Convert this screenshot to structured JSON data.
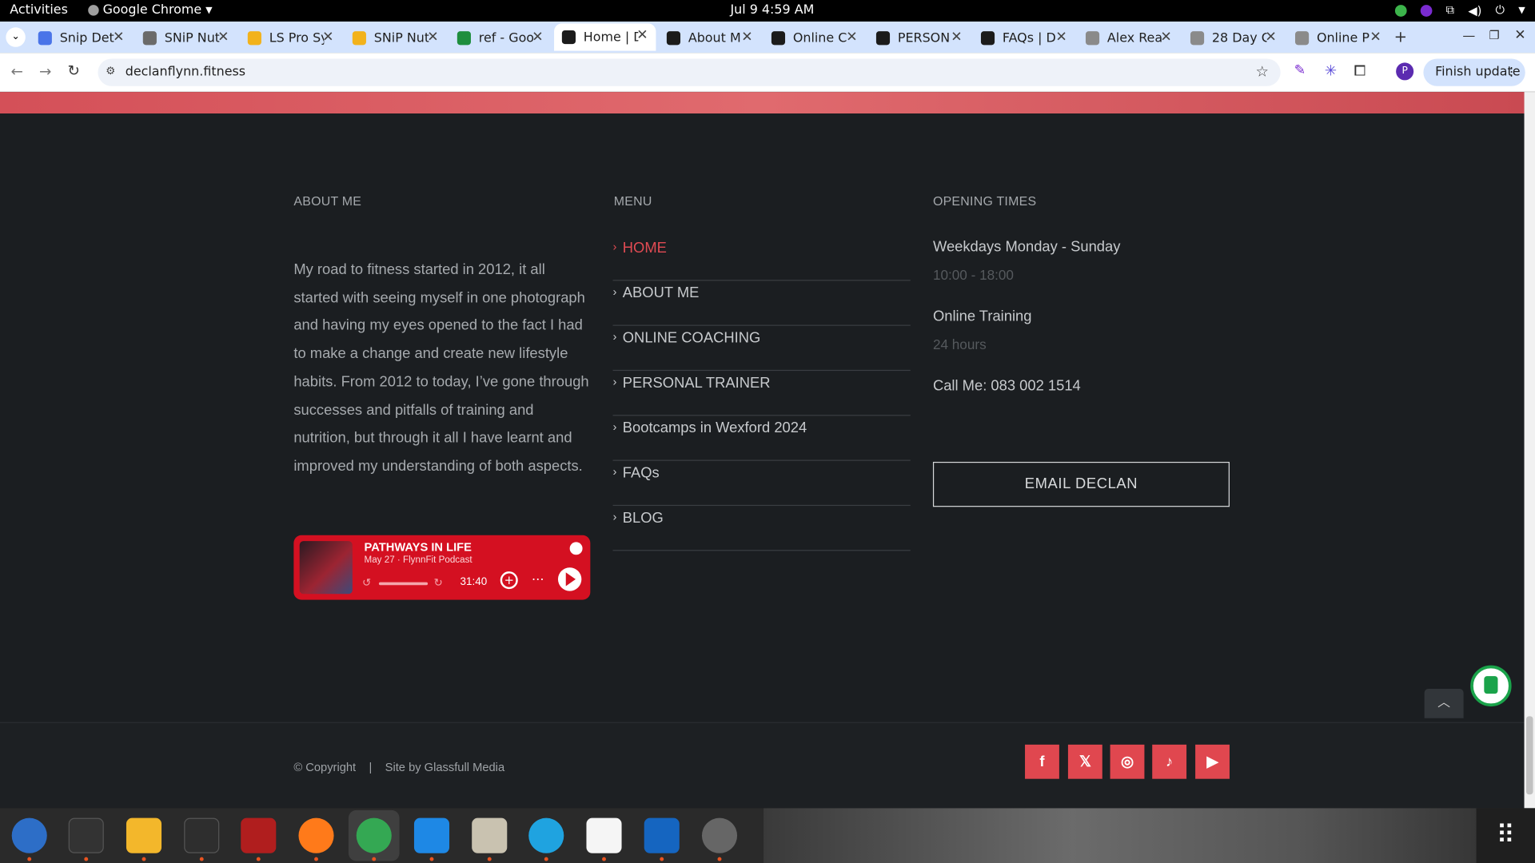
{
  "topbar": {
    "activities": "Activities",
    "app_name": "Google Chrome",
    "clock": "Jul 9  4:59 AM"
  },
  "tabs": [
    {
      "label": "Snip Det",
      "color": "#4a74e8"
    },
    {
      "label": "SNiP Nut",
      "color": "#6a6a6a"
    },
    {
      "label": "LS Pro Sy",
      "color": "#f2b21b"
    },
    {
      "label": "SNiP Nut",
      "color": "#f2b21b"
    },
    {
      "label": "ref - Goo",
      "color": "#1e8e3e"
    },
    {
      "label": "Home | D",
      "color": "#1b1b1b",
      "active": true
    },
    {
      "label": "About M",
      "color": "#1b1b1b"
    },
    {
      "label": "Online C",
      "color": "#1b1b1b"
    },
    {
      "label": "PERSON",
      "color": "#1b1b1b"
    },
    {
      "label": "FAQs | D",
      "color": "#1b1b1b"
    },
    {
      "label": "Alex Rea",
      "color": "#8a8a8a"
    },
    {
      "label": "28 Day C",
      "color": "#8a8a8a"
    },
    {
      "label": "Online P",
      "color": "#8a8a8a"
    }
  ],
  "toolbar": {
    "url": "declanflynn.fitness",
    "finish_update": "Finish update",
    "profile_initial": "P"
  },
  "footer": {
    "about": {
      "heading": "ABOUT ME",
      "text": "My road to fitness started in 2012, it all started with seeing myself in one photograph and having my eyes opened to the fact I had to make a change and create new lifestyle habits. From 2012 to today, I’ve gone through successes and pitfalls of training and nutrition, but through it all I have learnt and improved my understanding of both aspects."
    },
    "menu": {
      "heading": "MENU",
      "items": [
        "HOME",
        "ABOUT ME",
        "ONLINE COACHING",
        "PERSONAL TRAINER",
        "Bootcamps in Wexford 2024",
        "FAQs",
        "BLOG"
      ]
    },
    "opening": {
      "heading": "OPENING TIMES",
      "weekdays_label": "Weekdays Monday - Sunday",
      "weekdays_hours": "10:00 - 18:00",
      "online_label": "Online Training",
      "online_hours": "24 hours",
      "call": "Call Me: 083 002 1514",
      "email_button": "EMAIL DECLAN"
    },
    "podcast": {
      "title": "PATHWAYS IN LIFE",
      "subtitle": "May 27 · FlynnFit Podcast",
      "duration": "31:40"
    },
    "bottom": {
      "copyright": "© Copyright",
      "separator": "|",
      "site_by": "Site by Glassfull Media"
    },
    "social": [
      "f",
      "𝕏",
      "◎",
      "♪",
      "▶"
    ]
  },
  "colors": {
    "accent": "#e14b53",
    "background": "#1b1e21",
    "tabstrip": "#d3e3fd"
  }
}
